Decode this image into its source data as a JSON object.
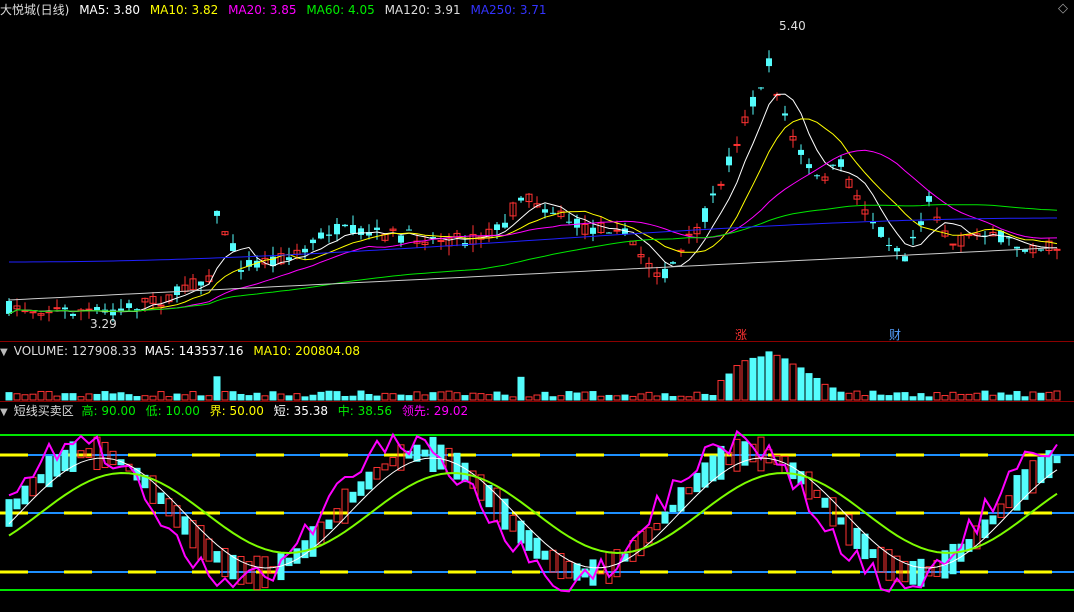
{
  "main_header": {
    "title": "大悦城(日线)",
    "ma5_label": "MA5:",
    "ma5_val": "3.80",
    "ma10_label": "MA10:",
    "ma10_val": "3.82",
    "ma20_label": "MA20:",
    "ma20_val": "3.85",
    "ma60_label": "MA60:",
    "ma60_val": "4.05",
    "ma120_label": "MA120:",
    "ma120_val": "3.91",
    "ma250_label": "MA250:",
    "ma250_val": "3.71"
  },
  "price_marks": {
    "high": "5.40",
    "low": "3.29"
  },
  "event_marks": {
    "zhang": "涨",
    "cai": "财"
  },
  "volume_header": {
    "label": "VOLUME:",
    "value": "127908.33",
    "ma5_label": "MA5:",
    "ma5_val": "143537.16",
    "ma10_label": "MA10:",
    "ma10_val": "200804.08"
  },
  "ind_header": {
    "name": "短线买卖区",
    "high_label": "高:",
    "high_val": "90.00",
    "low_label": "低:",
    "low_val": "10.00",
    "jie_label": "界:",
    "jie_val": "50.00",
    "duan_label": "短:",
    "duan_val": "35.38",
    "zhong_label": "中:",
    "zhong_val": "38.56",
    "lingxian_label": "领先:",
    "lingxian_val": "29.02"
  },
  "colors": {
    "up": "#ff3232",
    "down": "#54fcfc",
    "ma5": "#ffffff",
    "ma10": "#ffff00",
    "ma20": "#ff00ff",
    "ma60": "#00e600",
    "ma120": "#ffffff",
    "ma250": "#2020ff"
  },
  "icons": {
    "expand": "diamond-icon",
    "collapse": "triangle-down-icon"
  }
}
